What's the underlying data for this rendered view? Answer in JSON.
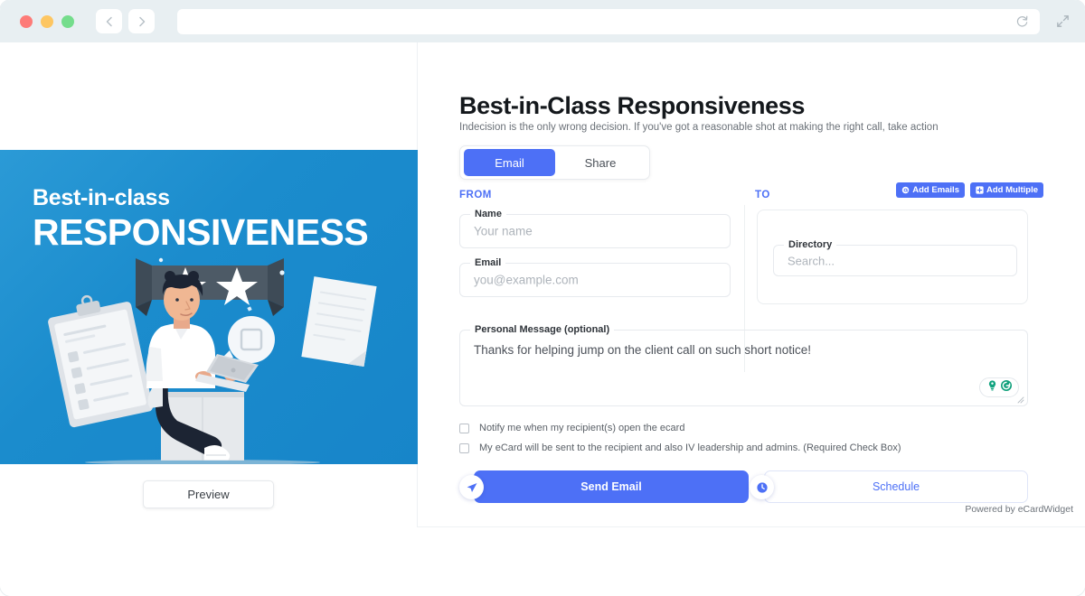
{
  "browser": {
    "url_value": "",
    "url_placeholder": "",
    "back_icon": "chevron-left-icon",
    "forward_icon": "chevron-right-icon",
    "reload_icon": "reload-icon",
    "expand_icon": "expand-arrows-icon"
  },
  "ecard": {
    "line1": "Best-in-class",
    "line2": "RESPONSIVENESS",
    "background_color": "#1b8ccd",
    "preview_label": "Preview"
  },
  "header": {
    "title": "Best-in-Class Responsiveness",
    "subtitle": "Indecision is the only wrong decision. If you've got a reasonable shot at making the right call, take action"
  },
  "tabs": [
    {
      "label": "Email",
      "active": true
    },
    {
      "label": "Share",
      "active": false
    }
  ],
  "from": {
    "section_label": "FROM",
    "name_field": {
      "legend": "Name",
      "value": "",
      "placeholder": "Your name"
    },
    "email_field": {
      "legend": "Email",
      "value": "",
      "placeholder": "you@example.com"
    }
  },
  "to": {
    "section_label": "TO",
    "add_emails_label": "Add Emails",
    "add_emails_icon": "at-sign-icon",
    "add_multiple_label": "Add Multiple",
    "add_multiple_icon": "plus-square-icon",
    "directory_field": {
      "legend": "Directory",
      "value": "",
      "placeholder": "Search..."
    }
  },
  "message": {
    "legend": "Personal Message (optional)",
    "value": "Thanks for helping jump on the client call on such short notice!",
    "assistant_icons": [
      "lightbulb-icon",
      "grammarly-refresh-icon"
    ],
    "assistant_color": "#10a37f"
  },
  "checkboxes": [
    {
      "label": "Notify me when my recipient(s) open the ecard",
      "checked": false
    },
    {
      "label": "My eCard will be sent to the recipient and also IV leadership and admins. (Required Check Box)",
      "checked": false
    }
  ],
  "actions": {
    "send_label": "Send Email",
    "send_icon": "paper-plane-icon",
    "schedule_label": "Schedule",
    "schedule_icon": "clock-icon"
  },
  "footer": {
    "powered_by": "Powered by eCardWidget"
  },
  "colors": {
    "accent_blue": "#4d70f6",
    "card_blue": "#1b8ccd",
    "teal": "#10a37f"
  }
}
